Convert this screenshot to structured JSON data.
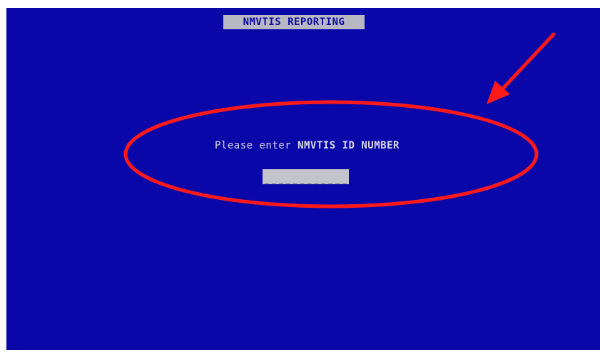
{
  "screen": {
    "title": "NMVTIS REPORTING",
    "prompt_text": "Please enter ",
    "prompt_field_name": "NMVTIS ID NUMBER",
    "id_input": {
      "value": "",
      "placeholder": ""
    }
  },
  "annotation": {
    "color": "#ff0000",
    "shapes": [
      "ellipse",
      "arrow"
    ]
  },
  "colors": {
    "screen_background": "#0a07a9",
    "title_bar_background": "#b8b8c4",
    "text": "#d8d8e4",
    "input_background": "#c4c4cc"
  }
}
